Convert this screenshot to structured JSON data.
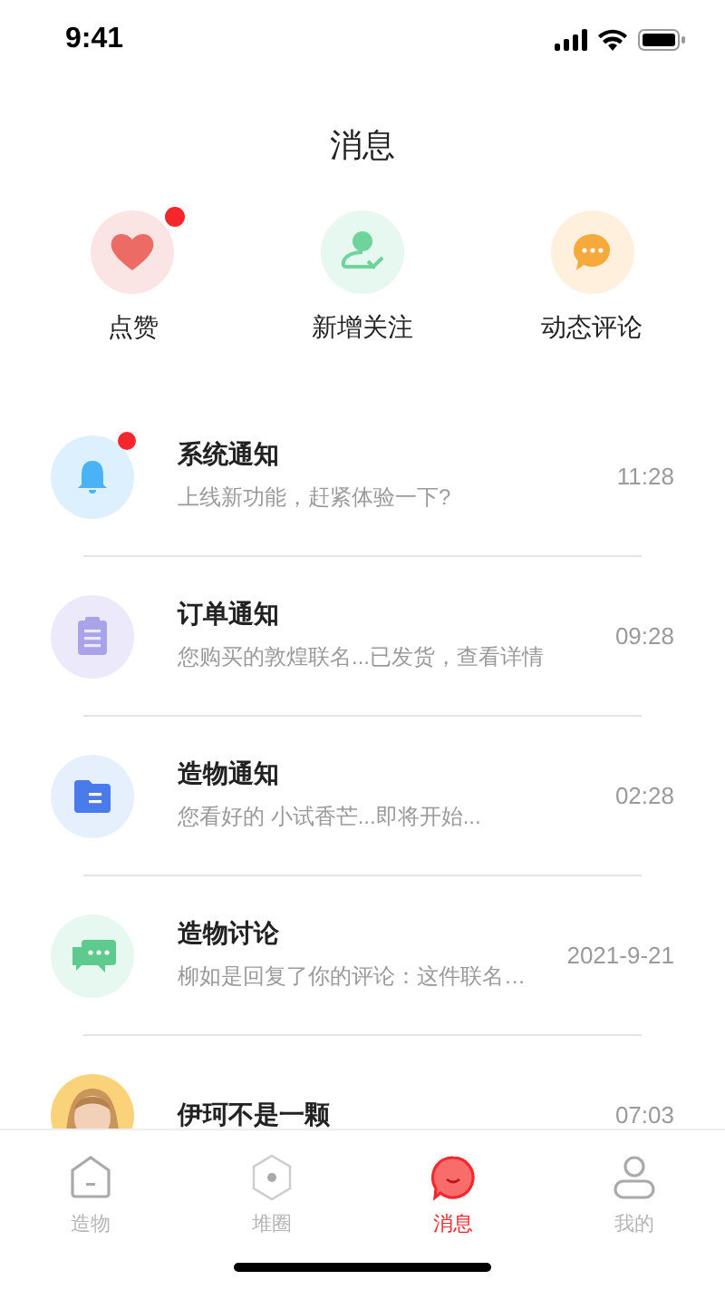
{
  "status_bar": {
    "time": "9:41"
  },
  "header": {
    "title": "消息"
  },
  "quick_actions": [
    {
      "kind": "like",
      "label": "点赞",
      "unread": true
    },
    {
      "kind": "follow",
      "label": "新增关注",
      "unread": false
    },
    {
      "kind": "comment",
      "label": "动态评论",
      "unread": false
    }
  ],
  "messages": [
    {
      "kind": "system",
      "title": "系统通知",
      "preview": "上线新功能，赶紧体验一下?",
      "time": "11:28",
      "unread": true
    },
    {
      "kind": "order",
      "title": "订单通知",
      "preview": "您购买的敦煌联名...已发货，查看详情",
      "time": "09:28",
      "unread": false
    },
    {
      "kind": "product",
      "title": "造物通知",
      "preview": "您看好的 小试香芒...即将开始...",
      "time": "02:28",
      "unread": false
    },
    {
      "kind": "discussion",
      "title": "造物讨论",
      "preview": "柳如是回复了你的评论：这件联名…",
      "time": "2021-9-21",
      "unread": false
    },
    {
      "kind": "user",
      "title": "伊珂不是一颗",
      "time": "07:03",
      "unread": false
    }
  ],
  "tab_bar": [
    {
      "kind": "home",
      "label": "造物",
      "selected": false
    },
    {
      "kind": "circle",
      "label": "堆圈",
      "selected": false
    },
    {
      "kind": "message",
      "label": "消息",
      "selected": true
    },
    {
      "kind": "profile",
      "label": "我的",
      "selected": false
    }
  ]
}
